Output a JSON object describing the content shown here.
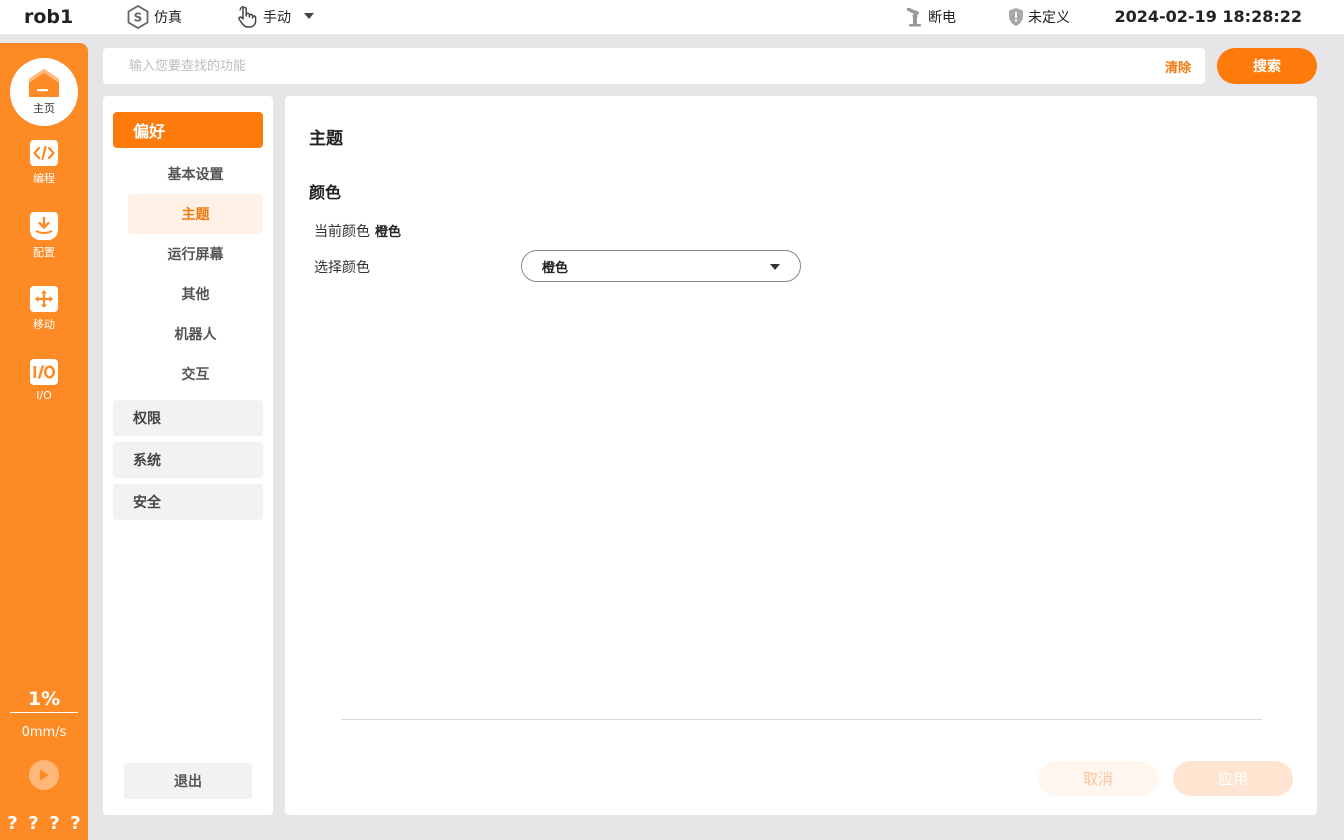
{
  "topbar": {
    "robot_name": "rob1",
    "mode_sim": "仿真",
    "mode_manual": "手动",
    "power_status": "断电",
    "safety_status": "未定义",
    "datetime": "2024-02-19 18:28:22"
  },
  "sidebar": {
    "items": [
      {
        "label": "主页",
        "icon": "home-icon"
      },
      {
        "label": "编程",
        "icon": "code-icon"
      },
      {
        "label": "配置",
        "icon": "config-download-icon"
      },
      {
        "label": "移动",
        "icon": "move-arrows-icon"
      },
      {
        "label": "I/O",
        "icon": "io-icon"
      }
    ],
    "speed_percent": "1%",
    "speed_value": "0mm/s",
    "bottom_marks": [
      "?",
      "?",
      "?",
      "?"
    ]
  },
  "search": {
    "placeholder": "输入您要查找的功能",
    "clear_label": "清除",
    "search_label": "搜索"
  },
  "submenu": {
    "active_group": "偏好",
    "items": [
      "基本设置",
      "主题",
      "运行屏幕",
      "其他",
      "机器人",
      "交互"
    ],
    "selected_item": "主题",
    "groups": [
      "权限",
      "系统",
      "安全"
    ],
    "exit_label": "退出"
  },
  "content": {
    "title": "主题",
    "section": "颜色",
    "current_color_label": "当前颜色",
    "current_color_value": "橙色",
    "select_color_label": "选择颜色",
    "select_color_value": "橙色",
    "cancel_label": "取消",
    "apply_label": "应用"
  },
  "colors": {
    "accent": "#fe7a0a",
    "sidebar": "#fe8a25",
    "selected_bg": "#fff1e5"
  }
}
